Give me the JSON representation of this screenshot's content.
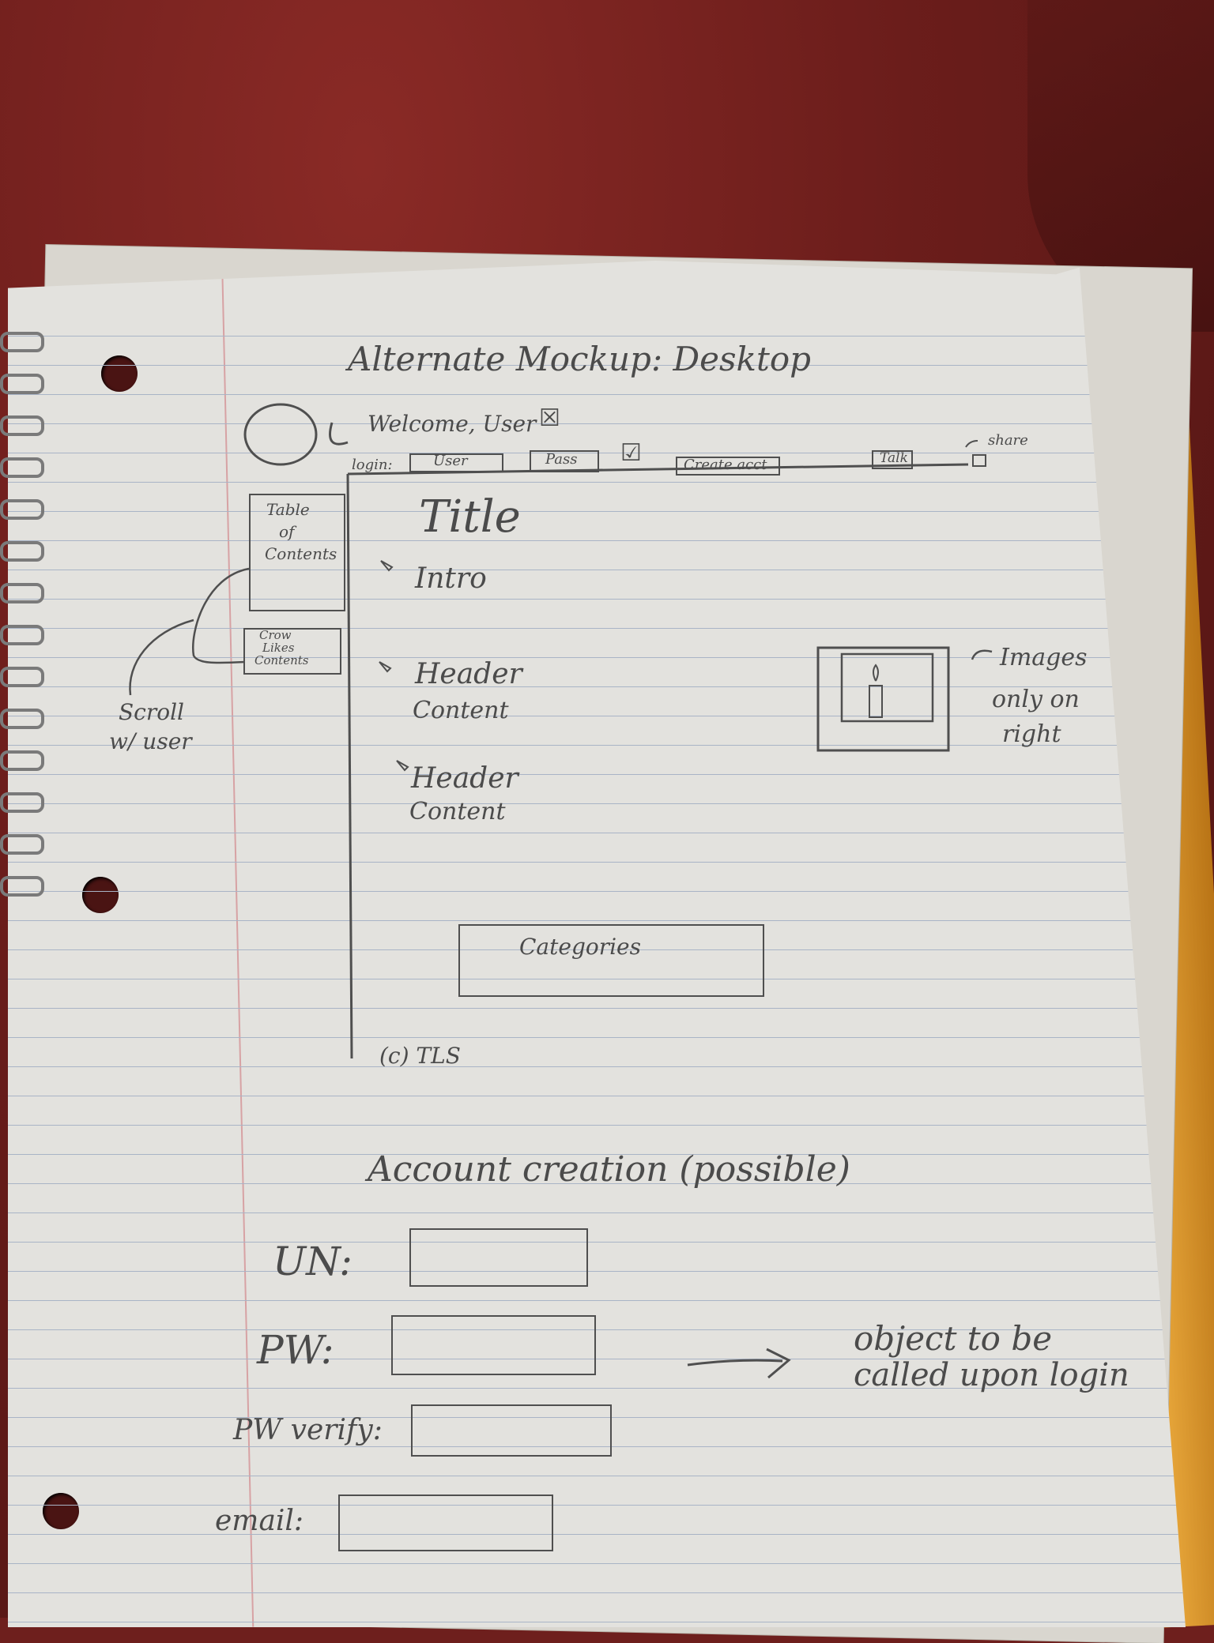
{
  "mockup": {
    "title": "Alternate Mockup: Desktop",
    "header": {
      "welcome": "Welcome, User",
      "welcome_checkbox": "☒",
      "login_label": "login:",
      "user_field": "User",
      "pass_field": "Pass",
      "remember_checkbox": "☑",
      "create_account": "Create acct",
      "talk": "Talk",
      "share_label": "share"
    },
    "sidebar": {
      "toc": [
        "Table",
        "of",
        "Contents"
      ],
      "small_box": [
        "Crow",
        "Likes",
        "Contents"
      ],
      "annotation": [
        "Scroll",
        "w/ user"
      ]
    },
    "content": {
      "title": "Title",
      "intro": "Intro",
      "sections": [
        {
          "header": "Header",
          "body": "Content"
        },
        {
          "header": "Header",
          "body": "Content"
        }
      ],
      "categories": "Categories",
      "footer": "(c) TLS"
    },
    "image_note": [
      "Images",
      "only on",
      "right"
    ]
  },
  "account": {
    "title": "Account creation (possible)",
    "fields": [
      {
        "label": "UN:"
      },
      {
        "label": "PW:"
      },
      {
        "label": "PW verify:"
      },
      {
        "label": "email:"
      }
    ],
    "note": [
      "object to be",
      "called upon login"
    ]
  },
  "colors": {
    "cloth": "#6e1f1d",
    "paper": "#e3e2de",
    "rule_lines": "#a9b4c6",
    "margin_line": "#d7a2a4",
    "pencil": "#4b4b4b",
    "folder": "#e7a63a"
  }
}
